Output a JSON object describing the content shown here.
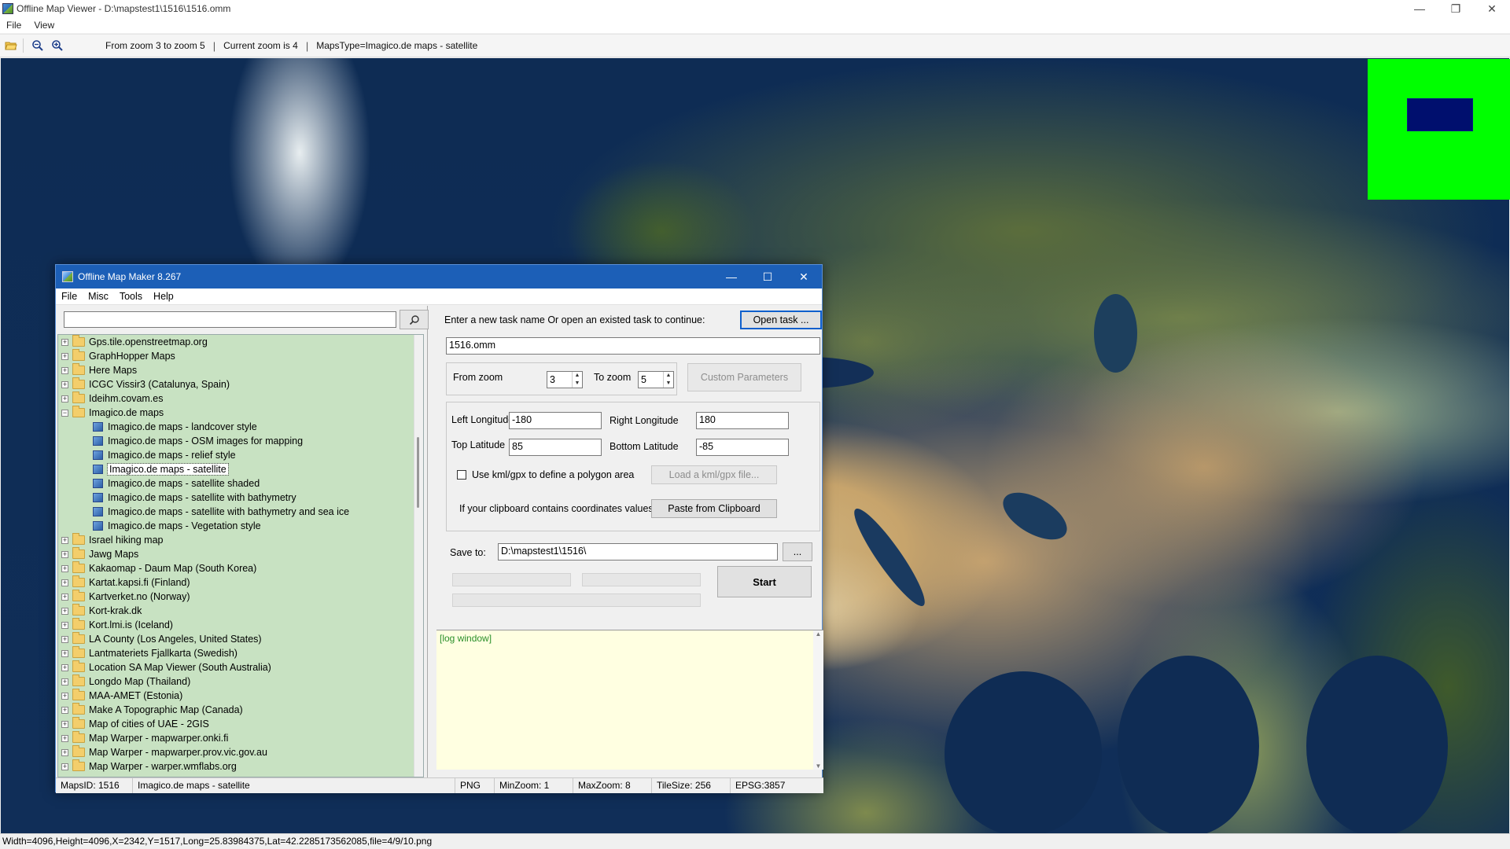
{
  "viewer": {
    "title": "Offline Map Viewer - D:\\mapstest1\\1516\\1516.omm",
    "window_controls": [
      "—",
      "❐",
      "✕"
    ],
    "menu": [
      "File",
      "View"
    ],
    "toolbar_info": {
      "zoom_range": "From zoom 3 to zoom 5",
      "current_zoom": "Current zoom is 4",
      "maps_type": "MapsType=Imagico.de maps - satellite",
      "separator": "|"
    },
    "status": "Width=4096,Height=4096,X=2342,Y=1517,Long=25.83984375,Lat=42.2285173562085,file=4/9/10.png",
    "overview_colors": {
      "background": "#00ff00",
      "viewport": "#000f6e"
    }
  },
  "dialog": {
    "title": "Offline Map Maker 8.267",
    "window_controls": [
      "—",
      "☐",
      "✕"
    ],
    "menu": [
      "File",
      "Misc",
      "Tools",
      "Help"
    ],
    "search": {
      "value": "",
      "button_icon": "search-icon"
    },
    "tree": [
      {
        "label": "Gps.tile.openstreetmap.org",
        "type": "folder",
        "expander": "+"
      },
      {
        "label": "GraphHopper Maps",
        "type": "folder",
        "expander": "+"
      },
      {
        "label": "Here Maps",
        "type": "folder",
        "expander": "+"
      },
      {
        "label": "ICGC Vissir3 (Catalunya, Spain)",
        "type": "folder",
        "expander": "+"
      },
      {
        "label": "Ideihm.covam.es",
        "type": "folder",
        "expander": "+"
      },
      {
        "label": "Imagico.de maps",
        "type": "folder-open",
        "expander": "−"
      },
      {
        "label": "Imagico.de maps - landcover style",
        "type": "map"
      },
      {
        "label": "Imagico.de maps - OSM images for mapping",
        "type": "map"
      },
      {
        "label": "Imagico.de maps - relief style",
        "type": "map"
      },
      {
        "label": "Imagico.de maps - satellite",
        "type": "map",
        "selected": true
      },
      {
        "label": "Imagico.de maps - satellite shaded",
        "type": "map"
      },
      {
        "label": "Imagico.de maps - satellite with bathymetry",
        "type": "map"
      },
      {
        "label": "Imagico.de maps - satellite with bathymetry and sea ice",
        "type": "map"
      },
      {
        "label": "Imagico.de maps - Vegetation style",
        "type": "map"
      },
      {
        "label": "Israel hiking map",
        "type": "folder",
        "expander": "+"
      },
      {
        "label": "Jawg Maps",
        "type": "folder",
        "expander": "+"
      },
      {
        "label": "Kakaomap - Daum Map (South Korea)",
        "type": "folder",
        "expander": "+"
      },
      {
        "label": "Kartat.kapsi.fi (Finland)",
        "type": "folder",
        "expander": "+"
      },
      {
        "label": "Kartverket.no (Norway)",
        "type": "folder",
        "expander": "+"
      },
      {
        "label": "Kort-krak.dk",
        "type": "folder",
        "expander": "+"
      },
      {
        "label": "Kort.lmi.is (Iceland)",
        "type": "folder",
        "expander": "+"
      },
      {
        "label": "LA County (Los Angeles, United States)",
        "type": "folder",
        "expander": "+"
      },
      {
        "label": "Lantmateriets Fjallkarta (Swedish)",
        "type": "folder",
        "expander": "+"
      },
      {
        "label": "Location SA Map Viewer (South Australia)",
        "type": "folder",
        "expander": "+"
      },
      {
        "label": "Longdo Map (Thailand)",
        "type": "folder",
        "expander": "+"
      },
      {
        "label": "MAA-AMET (Estonia)",
        "type": "folder",
        "expander": "+"
      },
      {
        "label": "Make A Topographic Map (Canada)",
        "type": "folder",
        "expander": "+"
      },
      {
        "label": "Map of cities of UAE - 2GIS",
        "type": "folder",
        "expander": "+"
      },
      {
        "label": "Map Warper - mapwarper.onki.fi",
        "type": "folder",
        "expander": "+"
      },
      {
        "label": "Map Warper - mapwarper.prov.vic.gov.au",
        "type": "folder",
        "expander": "+"
      },
      {
        "label": "Map Warper - warper.wmflabs.org",
        "type": "folder",
        "expander": "+"
      }
    ],
    "task": {
      "prompt": "Enter a new task name Or open an existed task to continue:",
      "open_button": "Open task ...",
      "name_value": "1516.omm"
    },
    "zoom": {
      "from_label": "From zoom",
      "from_value": "3",
      "to_label": "To zoom",
      "to_value": "5",
      "custom_button": "Custom Parameters"
    },
    "bounds": {
      "left_lon_label": "Left Longitude",
      "left_lon_value": "-180",
      "right_lon_label": "Right Longitude",
      "right_lon_value": "180",
      "top_lat_label": "Top Latitude",
      "top_lat_value": "85",
      "bottom_lat_label": "Bottom Latitude",
      "bottom_lat_value": "-85",
      "kml_checkbox_label": "Use kml/gpx to define a polygon area",
      "load_kml_button": "Load a kml/gpx file...",
      "clipboard_label": "If your clipboard contains coordinates values:",
      "paste_button": "Paste from Clipboard"
    },
    "save": {
      "label": "Save to:",
      "value": "D:\\mapstest1\\1516\\",
      "browse_button": "...",
      "start_button": "Start"
    },
    "log": {
      "text": "[log window]"
    },
    "status": {
      "maps_id": "MapsID: 1516",
      "map_name": "Imagico.de maps - satellite",
      "format": "PNG",
      "min_zoom": "MinZoom: 1",
      "max_zoom": "MaxZoom: 8",
      "tile_size": "TileSize: 256",
      "epsg": "EPSG:3857"
    }
  }
}
